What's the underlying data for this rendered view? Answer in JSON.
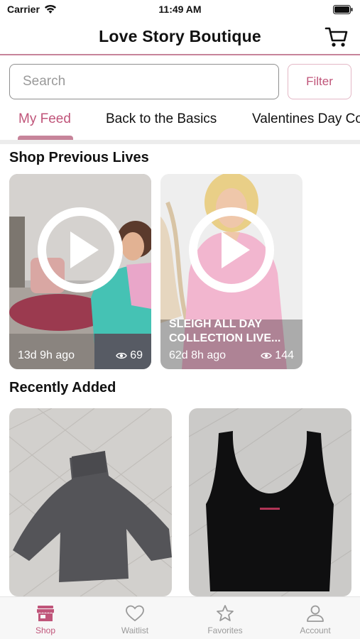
{
  "status_bar": {
    "carrier": "Carrier",
    "time": "11:49 AM"
  },
  "header": {
    "title": "Love Story Boutique",
    "cart_icon": "cart-icon"
  },
  "search": {
    "placeholder": "Search",
    "value": "",
    "filter_label": "Filter"
  },
  "tabs": [
    {
      "label": "My Feed",
      "active": true
    },
    {
      "label": "Back to the Basics",
      "active": false
    },
    {
      "label": "Valentines Day Co",
      "active": false
    }
  ],
  "sections": {
    "previous_lives": "Shop Previous Lives",
    "recently_added": "Recently Added"
  },
  "lives": [
    {
      "title": "",
      "ago": "13d 9h ago",
      "views": "69"
    },
    {
      "title": "SLEIGH ALL DAY COLLECTION LIVE...",
      "ago": "62d 8h ago",
      "views": "144"
    }
  ],
  "tab_bar": [
    {
      "label": "Shop",
      "icon": "store-icon",
      "active": true
    },
    {
      "label": "Waitlist",
      "icon": "heart-icon",
      "active": false
    },
    {
      "label": "Favorites",
      "icon": "star-icon",
      "active": false
    },
    {
      "label": "Account",
      "icon": "person-icon",
      "active": false
    }
  ],
  "colors": {
    "accent": "#c0557a",
    "accent_light": "#c7849a",
    "inactive": "#9a9a9a"
  }
}
